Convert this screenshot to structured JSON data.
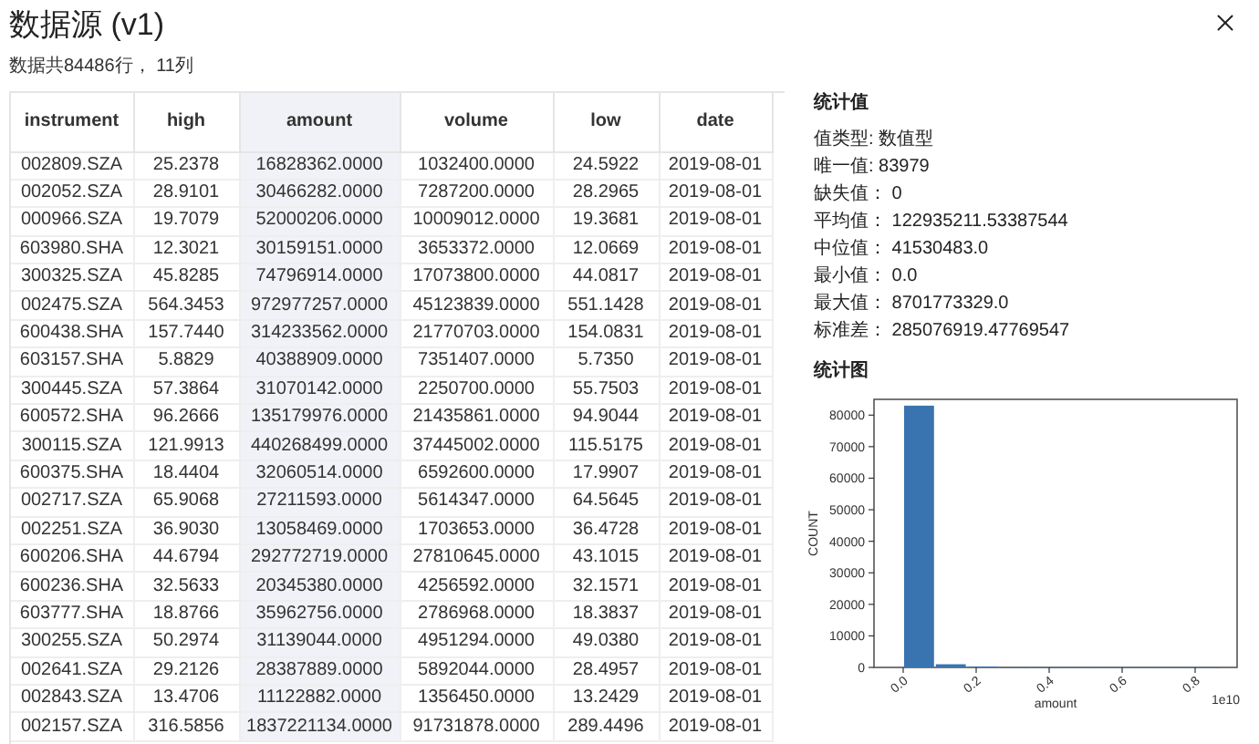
{
  "title": "数据源 (v1)",
  "summary": "数据共84486行， 11列",
  "table": {
    "columns": [
      {
        "label": "instrument",
        "selected": false
      },
      {
        "label": "high",
        "selected": false
      },
      {
        "label": "amount",
        "selected": true
      },
      {
        "label": "volume",
        "selected": false
      },
      {
        "label": "low",
        "selected": false
      },
      {
        "label": "date",
        "selected": false
      }
    ],
    "rows": [
      [
        "002809.SZA",
        "25.2378",
        "16828362.0000",
        "1032400.0000",
        "24.5922",
        "2019-08-01"
      ],
      [
        "002052.SZA",
        "28.9101",
        "30466282.0000",
        "7287200.0000",
        "28.2965",
        "2019-08-01"
      ],
      [
        "000966.SZA",
        "19.7079",
        "52000206.0000",
        "10009012.0000",
        "19.3681",
        "2019-08-01"
      ],
      [
        "603980.SHA",
        "12.3021",
        "30159151.0000",
        "3653372.0000",
        "12.0669",
        "2019-08-01"
      ],
      [
        "300325.SZA",
        "45.8285",
        "74796914.0000",
        "17073800.0000",
        "44.0817",
        "2019-08-01"
      ],
      [
        "002475.SZA",
        "564.3453",
        "972977257.0000",
        "45123839.0000",
        "551.1428",
        "2019-08-01"
      ],
      [
        "600438.SHA",
        "157.7440",
        "314233562.0000",
        "21770703.0000",
        "154.0831",
        "2019-08-01"
      ],
      [
        "603157.SHA",
        "5.8829",
        "40388909.0000",
        "7351407.0000",
        "5.7350",
        "2019-08-01"
      ],
      [
        "300445.SZA",
        "57.3864",
        "31070142.0000",
        "2250700.0000",
        "55.7503",
        "2019-08-01"
      ],
      [
        "600572.SHA",
        "96.2666",
        "135179976.0000",
        "21435861.0000",
        "94.9044",
        "2019-08-01"
      ],
      [
        "300115.SZA",
        "121.9913",
        "440268499.0000",
        "37445002.0000",
        "115.5175",
        "2019-08-01"
      ],
      [
        "600375.SHA",
        "18.4404",
        "32060514.0000",
        "6592600.0000",
        "17.9907",
        "2019-08-01"
      ],
      [
        "002717.SZA",
        "65.9068",
        "27211593.0000",
        "5614347.0000",
        "64.5645",
        "2019-08-01"
      ],
      [
        "002251.SZA",
        "36.9030",
        "13058469.0000",
        "1703653.0000",
        "36.4728",
        "2019-08-01"
      ],
      [
        "600206.SHA",
        "44.6794",
        "292772719.0000",
        "27810645.0000",
        "43.1015",
        "2019-08-01"
      ],
      [
        "600236.SHA",
        "32.5633",
        "20345380.0000",
        "4256592.0000",
        "32.1571",
        "2019-08-01"
      ],
      [
        "603777.SHA",
        "18.8766",
        "35962756.0000",
        "2786968.0000",
        "18.3837",
        "2019-08-01"
      ],
      [
        "300255.SZA",
        "50.2974",
        "31139044.0000",
        "4951294.0000",
        "49.0380",
        "2019-08-01"
      ],
      [
        "002641.SZA",
        "29.2126",
        "28387889.0000",
        "5892044.0000",
        "28.4957",
        "2019-08-01"
      ],
      [
        "002843.SZA",
        "13.4706",
        "11122882.0000",
        "1356450.0000",
        "13.2429",
        "2019-08-01"
      ],
      [
        "002157.SZA",
        "316.5856",
        "1837221134.0000",
        "91731878.0000",
        "289.4496",
        "2019-08-01"
      ]
    ]
  },
  "stats": {
    "heading": "统计值",
    "lines": [
      "值类型: 数值型",
      "唯一值: 83979",
      "缺失值： 0",
      "平均值： 122935211.53387544",
      "中位值： 41530483.0",
      "最小值： 0.0",
      "最大值： 8701773329.0",
      "标准差： 285076919.47769547"
    ]
  },
  "chart": {
    "heading": "统计图",
    "chart_data": {
      "type": "bar",
      "xlabel": "amount",
      "ylabel": "COUNT",
      "x": [
        0.0435,
        0.1305,
        0.2175,
        0.3045,
        0.3915,
        0.4785,
        0.5655,
        0.6525,
        0.7395,
        0.8265
      ],
      "series": [
        {
          "color": "#3a74b0",
          "values": [
            83000,
            1000,
            300,
            0,
            0,
            0,
            0,
            0,
            0,
            0
          ]
        }
      ],
      "xlim": [
        -0.08,
        0.915
      ],
      "ylim": [
        0,
        85000
      ],
      "xticks": [
        {
          "value": 0,
          "label": "0.0"
        },
        {
          "value": 0.2,
          "label": "0.2"
        },
        {
          "value": 0.4,
          "label": "0.4"
        },
        {
          "value": 0.6,
          "label": "0.6"
        },
        {
          "value": 0.8,
          "label": "0.8"
        }
      ],
      "yticks": [
        0,
        10000,
        20000,
        30000,
        40000,
        50000,
        60000,
        70000,
        80000
      ],
      "annotations": [
        "1e10"
      ]
    }
  }
}
